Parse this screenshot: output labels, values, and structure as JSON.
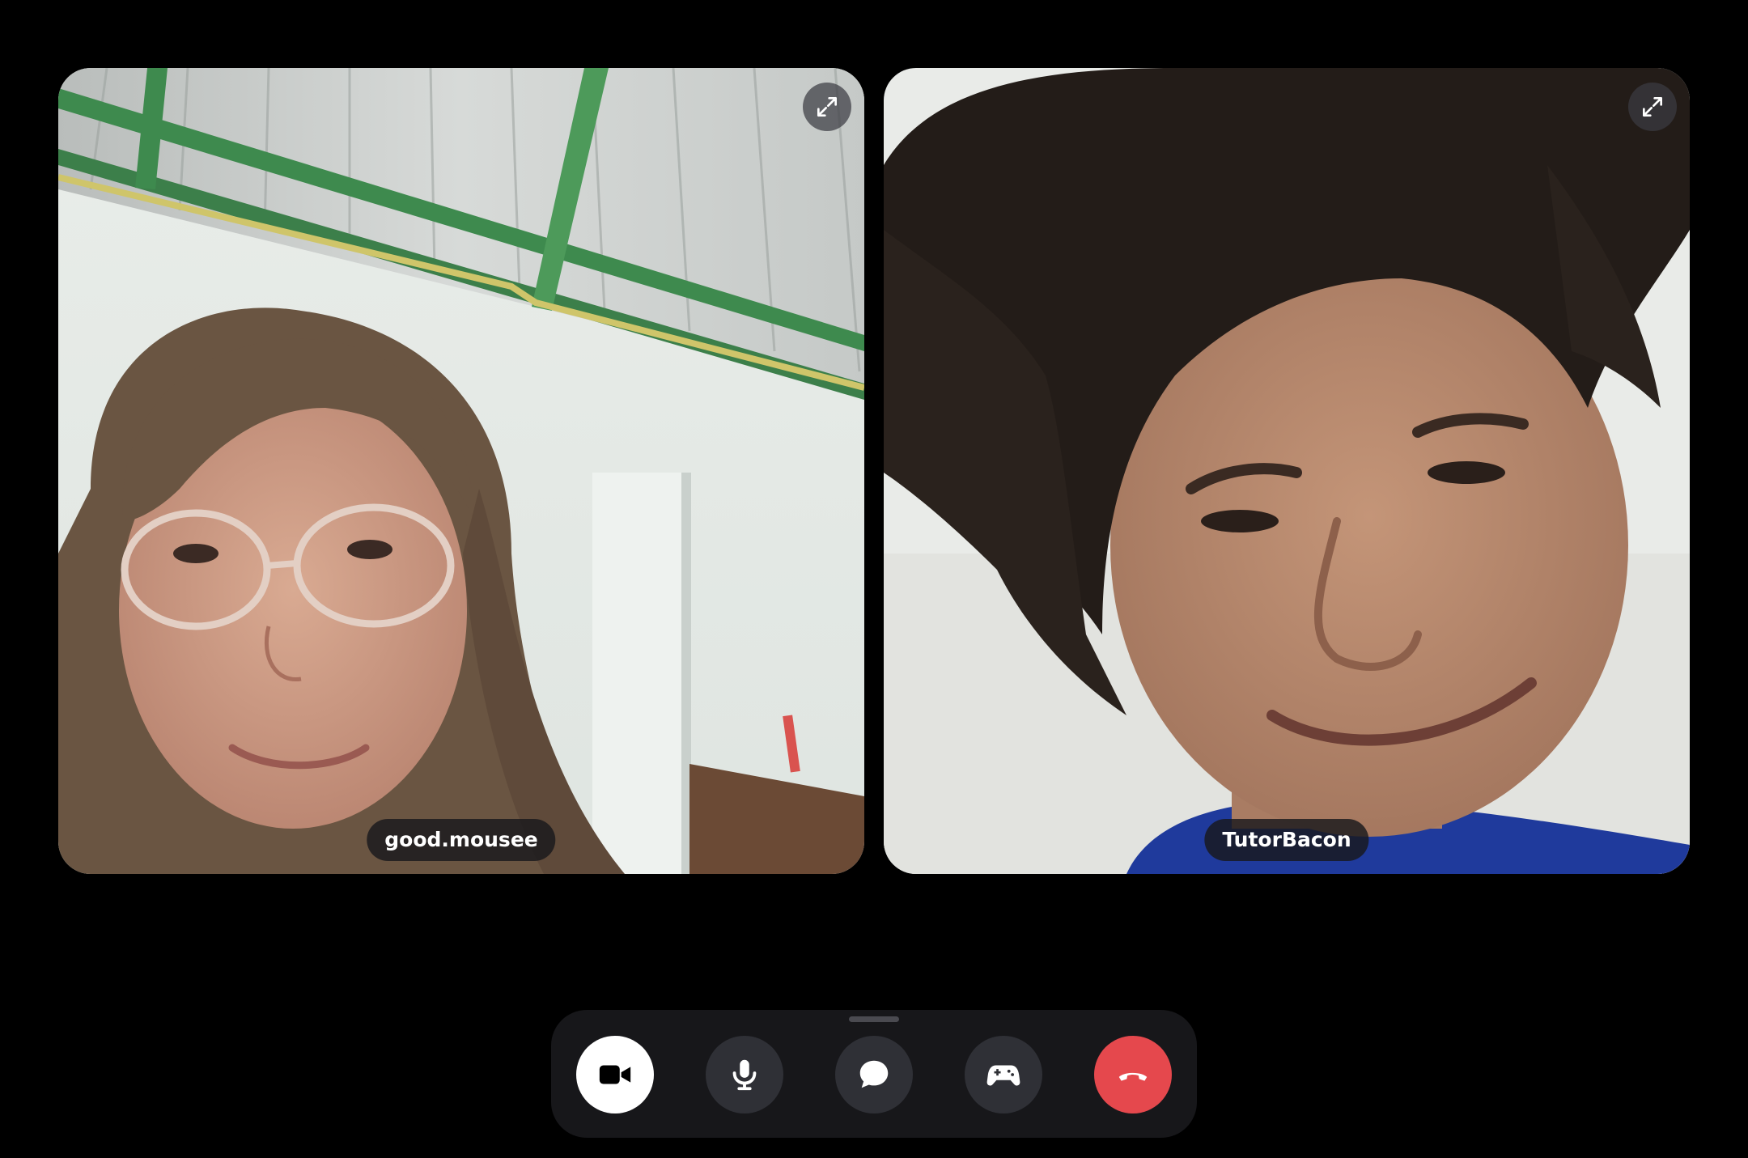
{
  "participants": [
    {
      "name": "good.mousee"
    },
    {
      "name": "TutorBacon"
    }
  ],
  "tile_icons": {
    "expand": "expand-arrows-icon"
  },
  "controls": [
    {
      "id": "camera",
      "icon": "video-camera-icon",
      "active": true
    },
    {
      "id": "microphone",
      "icon": "microphone-icon",
      "active": false
    },
    {
      "id": "chat",
      "icon": "chat-bubble-icon",
      "active": false
    },
    {
      "id": "activities",
      "icon": "game-controller-icon",
      "active": false
    },
    {
      "id": "hang-up",
      "icon": "hang-up-phone-icon",
      "active": false
    }
  ],
  "colors": {
    "background": "#000000",
    "control_bar": "#17171a",
    "control_button": "#2f3036",
    "camera_active": "#ffffff",
    "hang_up": "#e5484d"
  }
}
